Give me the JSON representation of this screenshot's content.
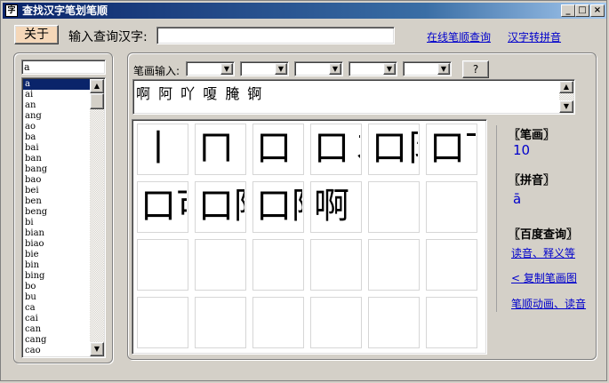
{
  "window": {
    "title": "查找汉字笔划笔顺",
    "min_label": "_",
    "max_label": "□",
    "close_label": "×"
  },
  "toolbar": {
    "about_label": "关于",
    "input_label": "输入查询汉字:",
    "input_value": "",
    "link_online_order": "在线笔顺查询",
    "link_to_pinyin": "汉字转拼音"
  },
  "pinyin_list": {
    "search_value": "a",
    "items": [
      "a",
      "ai",
      "an",
      "ang",
      "ao",
      "ba",
      "bai",
      "ban",
      "bang",
      "bao",
      "bei",
      "ben",
      "beng",
      "bi",
      "bian",
      "biao",
      "bie",
      "bin",
      "bing",
      "bo",
      "bu",
      "ca",
      "cai",
      "can",
      "cang",
      "cao"
    ],
    "selected_index": 0
  },
  "stroke_input": {
    "label": "笔画输入:",
    "combos": [
      "",
      "",
      "",
      "",
      ""
    ],
    "query_label": "?"
  },
  "chars": {
    "text": "啊 阿 吖 嗄 腌 锕"
  },
  "stroke_grid": {
    "steps": [
      "丨",
      "ㄇ",
      "口",
      "口㇇",
      "口阝",
      "口丅",
      "口可",
      "口阿",
      "口阿",
      "啊"
    ],
    "total_cells": 24
  },
  "info": {
    "strokes_heading": "〖笔画〗",
    "strokes_value": "10",
    "pinyin_heading": "〖拼音〗",
    "pinyin_value": "ā",
    "baidu_heading": "〖百度查询〗",
    "link_read": "读音、释义等",
    "link_copy": "< 复制笔画图",
    "link_anim": "笔顺动画、读音"
  }
}
